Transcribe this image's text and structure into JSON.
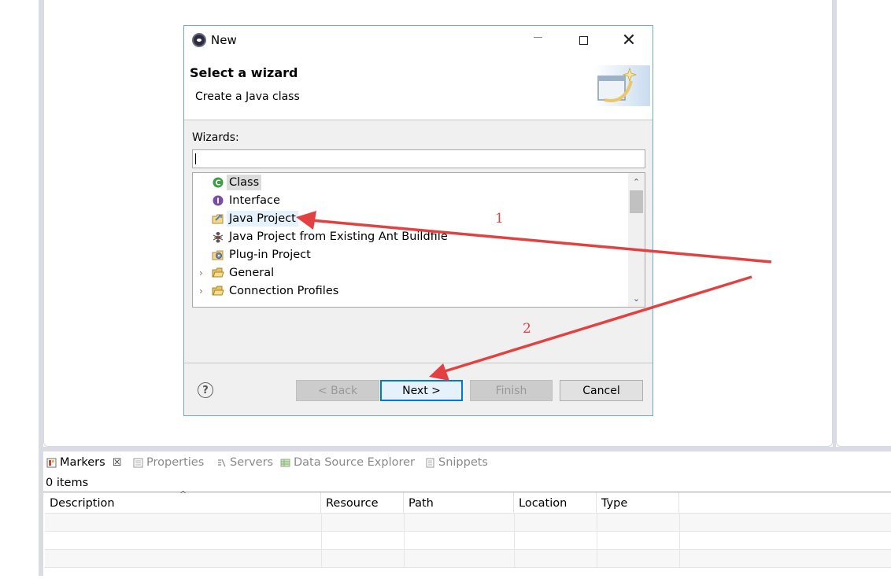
{
  "dialog": {
    "title": "New",
    "header_title": "Select a wizard",
    "header_description": "Create a Java class",
    "wizards_label": "Wizards:",
    "filter_value": "",
    "tree_items": [
      {
        "label": "Class",
        "icon": "class-icon",
        "selected": true
      },
      {
        "label": "Interface",
        "icon": "interface-icon"
      },
      {
        "label": "Java Project",
        "icon": "java-project-icon",
        "hovered": true
      },
      {
        "label": "Java Project from Existing Ant Buildfile",
        "icon": "ant-icon"
      },
      {
        "label": "Plug-in Project",
        "icon": "plugin-project-icon"
      },
      {
        "label": "General",
        "icon": "folder-icon",
        "expandable": true
      },
      {
        "label": "Connection Profiles",
        "icon": "folder-icon",
        "expandable": true
      }
    ],
    "buttons": {
      "help": "?",
      "back": "< Back",
      "next": "Next >",
      "finish": "Finish",
      "cancel": "Cancel"
    }
  },
  "bottom_panel": {
    "tabs": [
      {
        "label": "Markers",
        "icon": "markers-icon",
        "active": true,
        "close": "☒"
      },
      {
        "label": "Properties",
        "icon": "properties-icon"
      },
      {
        "label": "Servers",
        "icon": "servers-icon"
      },
      {
        "label": "Data Source Explorer",
        "icon": "data-source-icon"
      },
      {
        "label": "Snippets",
        "icon": "snippets-icon"
      }
    ],
    "items_count": "0 items",
    "columns": [
      "Description",
      "Resource",
      "Path",
      "Location",
      "Type"
    ]
  },
  "annotations": {
    "step1": "1",
    "step2": "2",
    "color": "#e34141"
  }
}
